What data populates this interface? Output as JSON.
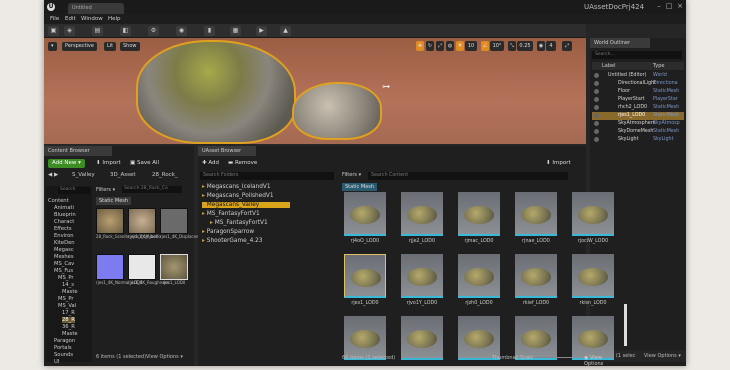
{
  "window": {
    "doc_tab": "Untitled",
    "project_title": "UAssetDocPrj424"
  },
  "menu": [
    "File",
    "Edit",
    "Window",
    "Help"
  ],
  "viewport": {
    "perspective": "Perspective",
    "lit": "Lit",
    "show": "Show",
    "grid_snap": "10",
    "rot_snap": "10°",
    "scale_snap": "0.25",
    "cam_speed": "4"
  },
  "outliner": {
    "tab": "World Outliner",
    "search_placeholder": "Search...",
    "col_label": "Label",
    "col_type": "Type",
    "rows": [
      {
        "label": "Untitled (Editor)",
        "type": "World"
      },
      {
        "label": "DirectionalLight",
        "type": "Directiona"
      },
      {
        "label": "Floor",
        "type": "StaticMesh"
      },
      {
        "label": "PlayerStart",
        "type": "PlayerStar"
      },
      {
        "label": "rhch2_LOD0",
        "type": "StaticMesh"
      },
      {
        "label": "rjes1_LOD0",
        "type": "StaticMesh"
      },
      {
        "label": "SkyAtmosphere",
        "type": "SkyAtmosp"
      },
      {
        "label": "SkyDomeMesh",
        "type": "StaticMesh"
      },
      {
        "label": "SkyLight",
        "type": "SkyLight"
      }
    ],
    "footer": "8 actors (1 selec",
    "view_options": "View Options ▾"
  },
  "content_browser": {
    "tab": "Content Browser",
    "add_new": "Add New ▾",
    "import": "Import",
    "save_all": "Save All",
    "crumbs": [
      "S_Valley",
      "3D_Asset",
      "28_Rock_"
    ],
    "search_placeholder": "Search",
    "search_assets_placeholder": "Search 28_Rock_Ca",
    "filters": "Filters ▾",
    "static_mesh_tag": "Static Mesh",
    "tree": [
      "Content",
      "Animati",
      "Blueprin",
      "Charact",
      "Effects",
      "Environ",
      "KiteDen",
      "Megasc",
      "Meshes",
      "MS_Cav",
      "MS_Fus",
      "MS_Pr",
      "14_s",
      "Maste",
      "MS_Pr",
      "MS_Val",
      "17_R",
      "28_R",
      "36_R",
      "Maste",
      "Paragon",
      "Portals",
      "Sounds",
      "UI"
    ],
    "assets": [
      {
        "name": "28_Rock_Granite_rjes1_4K_ord"
      },
      {
        "name": "rjes1_4K_Albedo"
      },
      {
        "name": "rjes1_4K_Displacement"
      },
      {
        "name": "rjes1_4K_Normal_LOD0"
      },
      {
        "name": "rjes1_4K_Roughness"
      },
      {
        "name": "rjes1_LOD0"
      }
    ],
    "status": "6 items (1 selected)",
    "view_options": "View Options ▾"
  },
  "uasset_browser": {
    "tab": "UAsset Browser",
    "add": "Add",
    "remove": "Remove",
    "import": "Import",
    "search_folders_placeholder": "Search Folders",
    "search_content_placeholder": "Search Content",
    "filters": "Filters ▾",
    "static_mesh_tag": "Static Mesh",
    "folders": [
      "Megascans_IcelandV1",
      "Megascans_PolishedV1",
      "Megascans_Valley",
      "MS_FantasyFortV1",
      "MS_FantasyFortV1",
      "ParagonSparrow",
      "ShooterGame_4.23"
    ],
    "meshes": [
      "rj4oO_LOD0",
      "rjje2_LOD0",
      "rjmac_LOD0",
      "rjnae_LOD0",
      "rjociW_LOD0",
      "rjes1_LOD0",
      "rjvo1Y_LOD0",
      "rjzh0_LOD0",
      "rkief_LOD0",
      "rkisn_LOD0",
      "",
      "",
      "",
      "",
      ""
    ],
    "status": "66 items (1 selected)",
    "thumbnail_scale": "Thumbnail Scale",
    "view_options": "View Options ▾"
  }
}
